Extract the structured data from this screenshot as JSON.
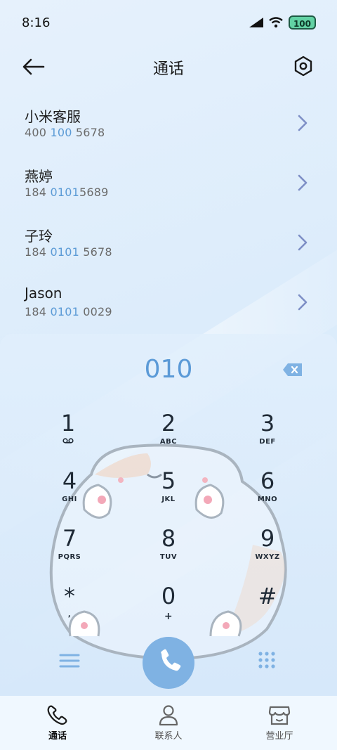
{
  "status_bar": {
    "time": "8:16",
    "battery": "100"
  },
  "header": {
    "title": "通话"
  },
  "contacts": [
    {
      "name": "小米客服",
      "number_parts": [
        "400 ",
        "100",
        " 5678"
      ]
    },
    {
      "name": "燕婷",
      "number_parts": [
        "184 ",
        "0101",
        "5689"
      ]
    },
    {
      "name": "子玲",
      "number_parts": [
        "184 ",
        "0101",
        " 5678"
      ]
    },
    {
      "name": "Jason",
      "number_parts": [
        "184 ",
        "0101",
        " 0029"
      ]
    }
  ],
  "dialer": {
    "input": "010",
    "keys": [
      {
        "digit": "1",
        "letters": ""
      },
      {
        "digit": "2",
        "letters": "ABC"
      },
      {
        "digit": "3",
        "letters": "DEF"
      },
      {
        "digit": "4",
        "letters": "GHI"
      },
      {
        "digit": "5",
        "letters": "JKL"
      },
      {
        "digit": "6",
        "letters": "MNO"
      },
      {
        "digit": "7",
        "letters": "PQRS"
      },
      {
        "digit": "8",
        "letters": "TUV"
      },
      {
        "digit": "9",
        "letters": "WXYZ"
      },
      {
        "digit": "*",
        "letters": ","
      },
      {
        "digit": "0",
        "letters": "+"
      },
      {
        "digit": "#",
        "letters": ""
      }
    ]
  },
  "bottom_nav": [
    {
      "label": "通话",
      "icon": "phone-icon",
      "active": true
    },
    {
      "label": "联系人",
      "icon": "person-icon",
      "active": false
    },
    {
      "label": "营业厅",
      "icon": "store-icon",
      "active": false
    }
  ],
  "colors": {
    "accent": "#5c9bd6",
    "call_button": "#7fb2e3"
  }
}
